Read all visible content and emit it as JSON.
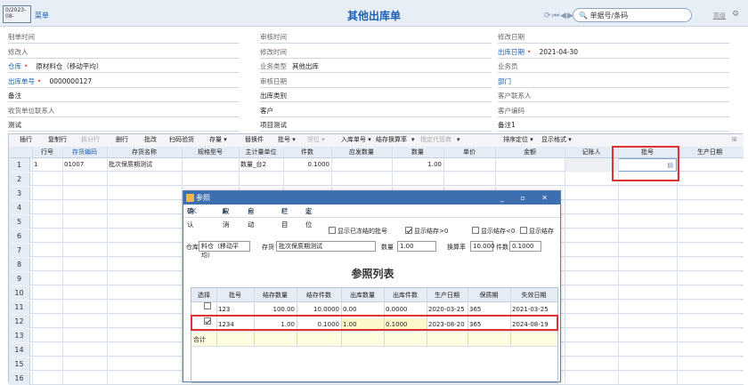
{
  "toolbar": {
    "chip_text": "0/2023-08-",
    "label": "菜单",
    "title": "其他出库单",
    "search_placeholder": "单据号/条码",
    "advanced": "高级"
  },
  "form": {
    "col1": [
      {
        "label": "制单时间",
        "value": "",
        "style": "n"
      },
      {
        "label": "修改人",
        "value": "",
        "style": "n"
      },
      {
        "label": "仓库",
        "value": "原材料仓（移动平均）",
        "style": "b",
        "req": true
      },
      {
        "label": "出库单号",
        "value": "0000000127",
        "style": "b",
        "req": true
      },
      {
        "label": "备注",
        "value": "",
        "style": "k"
      },
      {
        "label": "收货单位联系人",
        "value": "",
        "style": "n"
      },
      {
        "label": "测试",
        "value": "",
        "style": "k"
      }
    ],
    "col2": [
      {
        "label": "审核时间",
        "value": "",
        "style": "n"
      },
      {
        "label": "修改时间",
        "value": "",
        "style": "n"
      },
      {
        "label": "业务类型",
        "value": "其他出库",
        "style": "n"
      },
      {
        "label": "审核日期",
        "value": "",
        "style": "n"
      },
      {
        "label": "出库类别",
        "value": "",
        "style": "k"
      },
      {
        "label": "客户",
        "value": "",
        "style": "k"
      },
      {
        "label": "项目测试",
        "value": "",
        "style": "k"
      }
    ],
    "col3": [
      {
        "label": "修改日期",
        "value": "",
        "style": "n"
      },
      {
        "label": "出库日期",
        "value": "2021-04-30",
        "style": "b",
        "req": true
      },
      {
        "label": "业务员",
        "value": "",
        "style": "n"
      },
      {
        "label": "部门",
        "value": "",
        "style": "b"
      },
      {
        "label": "客户联系人",
        "value": "",
        "style": "n"
      },
      {
        "label": "客户编码",
        "value": "",
        "style": "n"
      },
      {
        "label": "备注1",
        "value": "",
        "style": "k"
      }
    ]
  },
  "grid": {
    "tools": [
      "插行",
      "复制行",
      "拆分行",
      "删行",
      "批改",
      "扫码验货",
      "存量 ▾",
      "替换件",
      "批号 ▾",
      "货位 ▾",
      "入库单号 ▾",
      "结存换算率",
      "▾",
      "指定代管商",
      "▾",
      "排序定位 ▾",
      "显示格式 ▾"
    ],
    "headers": [
      "行号",
      "存货编码",
      "存货名称",
      "规格型号",
      "主计量单位",
      "件数",
      "应发数量",
      "数量",
      "单价",
      "金额",
      "记账人",
      "批号",
      "生产日期"
    ],
    "row1": {
      "num": "1",
      "line": "1",
      "code": "01007",
      "name": "批次保质期测试",
      "unit": "数量_台2",
      "pieces": "0.1000",
      "qty": "1.00"
    },
    "row_numbers": [
      "1",
      "2",
      "3",
      "4",
      "5",
      "6",
      "7",
      "8",
      "9",
      "10",
      "11",
      "12",
      "13",
      "14",
      "15",
      "16"
    ]
  },
  "dialog": {
    "title": "参照",
    "tools": [
      "确认",
      "取消",
      "自动",
      "栏目",
      "定位"
    ],
    "options": [
      {
        "label": "显示已冻结的批号",
        "checked": false
      },
      {
        "label": "显示结存>0",
        "checked": true
      },
      {
        "label": "显示结存<0",
        "checked": false
      },
      {
        "label": "显示结存",
        "checked": false
      }
    ],
    "warehouse_label": "仓库",
    "warehouse_value": "料仓（移动平均）",
    "inventory_label": "存货",
    "inventory_value": "批次保质期测试",
    "qty_label": "数量",
    "qty_value": "1.00",
    "rate_label": "换算率",
    "rate_value": "10.000",
    "pieces_label": "件数",
    "pieces_value": "0.1000",
    "heading": "参照列表",
    "headers": [
      "选择",
      "批号",
      "结存数量",
      "结存件数",
      "出库数量",
      "出库件数",
      "生产日期",
      "保质期",
      "失效日期"
    ],
    "rows": [
      {
        "checked": false,
        "batch": "123",
        "stock": "100.00",
        "stock_pcs": "10.0000",
        "out": "0.00",
        "out_pcs": "0.0000",
        "prod": "2020-03-25",
        "shelf": "365",
        "expire": "2021-03-25"
      },
      {
        "checked": true,
        "batch": "1234",
        "stock": "1.00",
        "stock_pcs": "0.1000",
        "out": "1.00",
        "out_pcs": "0.1000",
        "prod": "2023-08-20",
        "shelf": "365",
        "expire": "2024-08-19"
      }
    ],
    "sum_label": "合计"
  }
}
